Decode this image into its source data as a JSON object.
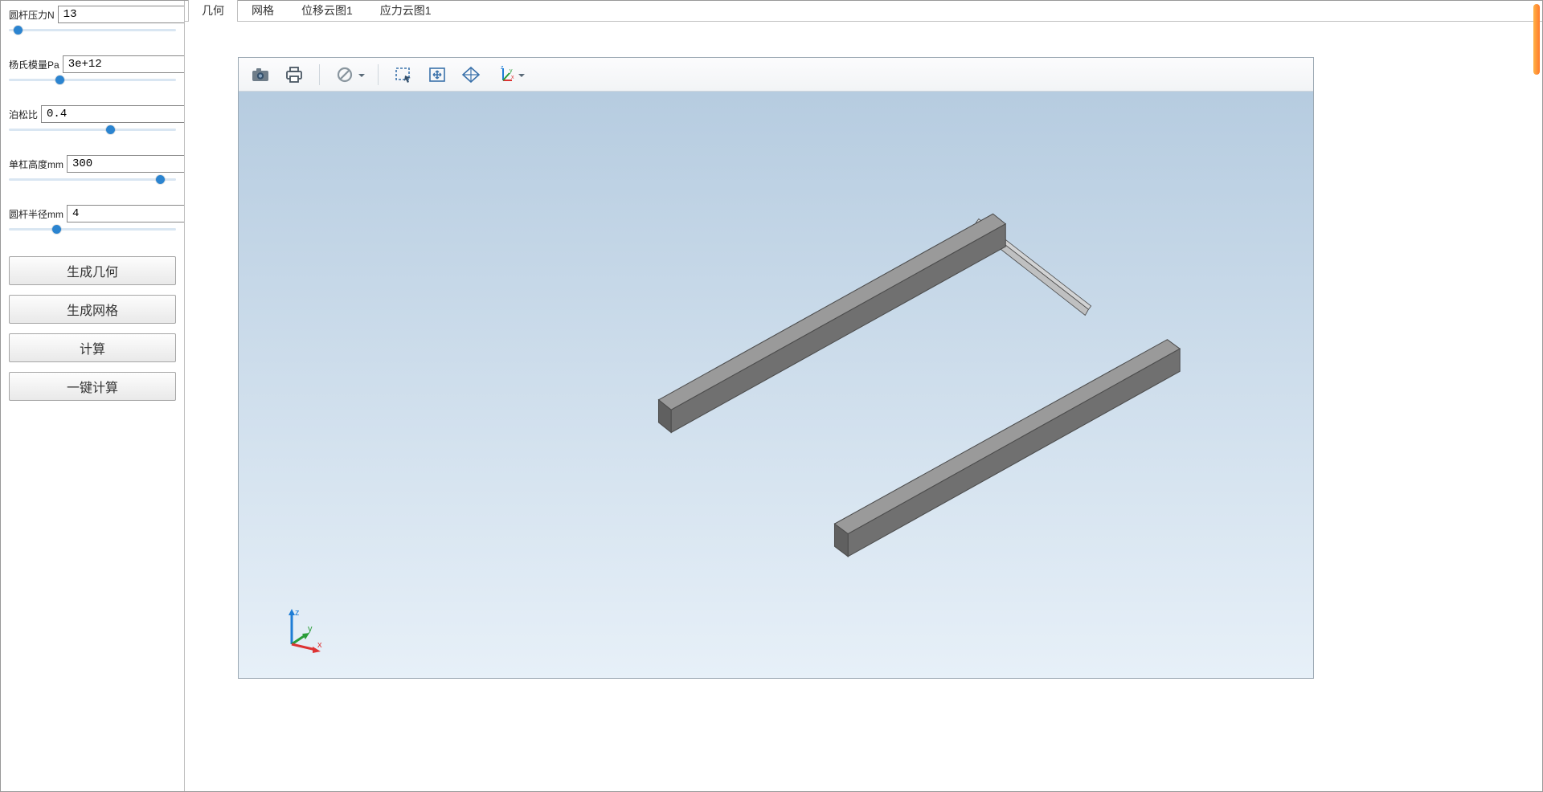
{
  "sidebar": {
    "params": [
      {
        "label": "圆杆压力N",
        "value": "13",
        "thumb_pct": 3
      },
      {
        "label": "杨氏模量Pa",
        "value": "3e+12",
        "thumb_pct": 28
      },
      {
        "label": "泊松比",
        "value": "0.4",
        "thumb_pct": 58
      },
      {
        "label": "单杠高度mm",
        "value": "300",
        "thumb_pct": 88
      },
      {
        "label": "圆杆半径mm",
        "value": "4",
        "thumb_pct": 26
      }
    ],
    "buttons": {
      "gen_geom": "生成几何",
      "gen_mesh": "生成网格",
      "compute": "计算",
      "one_click": "一键计算"
    }
  },
  "tabs": {
    "geometry": "几何",
    "mesh": "网格",
    "disp": "位移云图1",
    "stress": "应力云图1",
    "active": "geometry"
  },
  "toolbar_icons": {
    "snapshot": "camera-icon",
    "print": "printer-icon",
    "cancel": "no-symbol-icon",
    "select": "selection-box-icon",
    "fit": "zoom-fit-icon",
    "reset": "reset-view-icon",
    "axes": "axes-orientation-icon"
  },
  "triad_labels": {
    "x": "x",
    "y": "y",
    "z": "z"
  }
}
